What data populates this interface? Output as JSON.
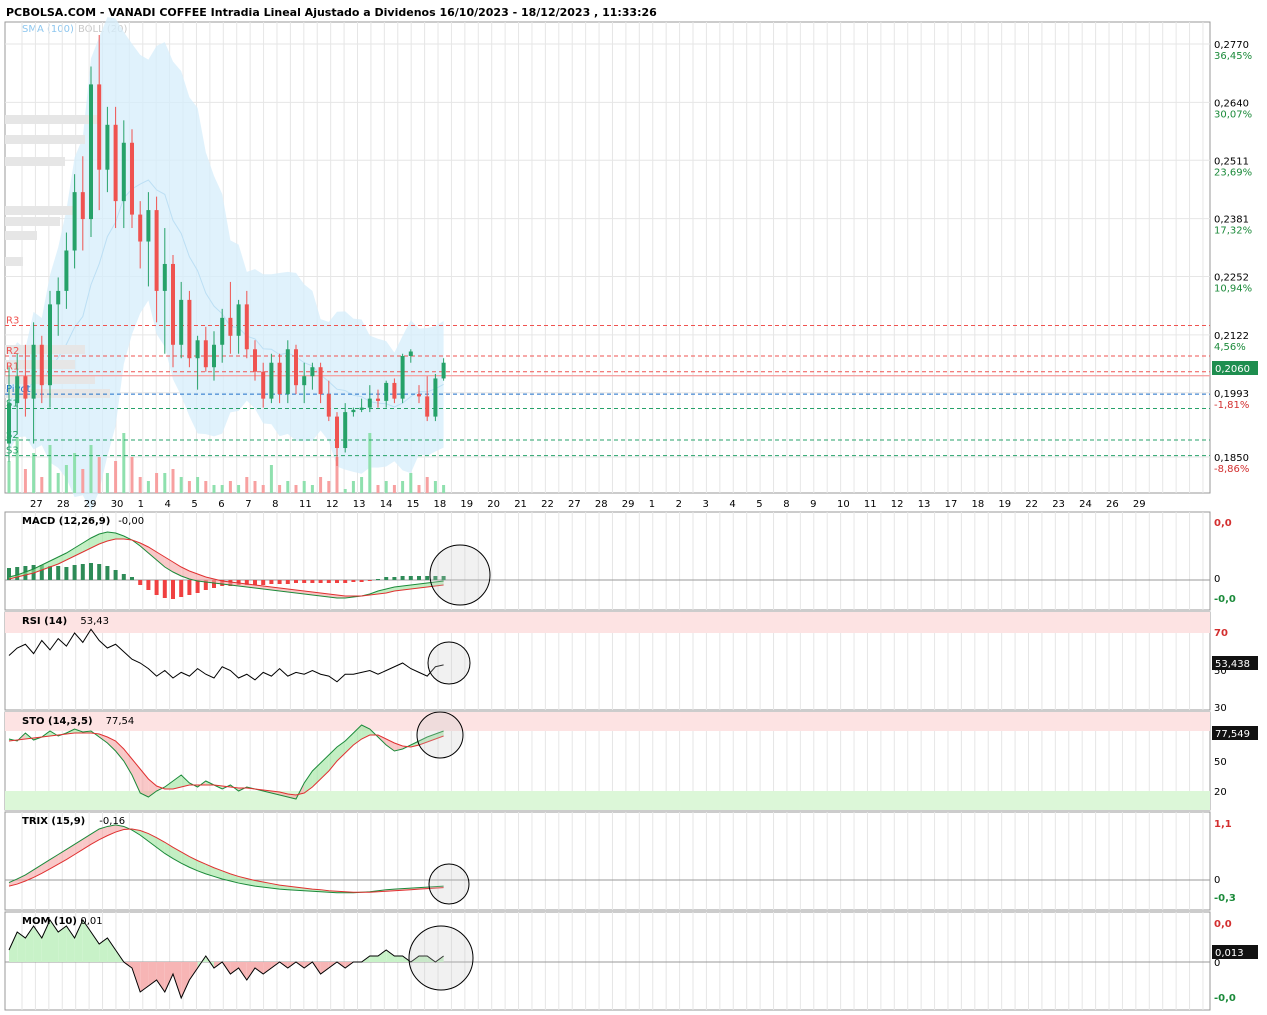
{
  "header": {
    "title": "PCBOLSA.COM - VANADI COFFEE Intradia Lineal Ajustado a Dividenos 16/10/2023 - 18/12/2023 , 11:33:26",
    "indicators": [
      "SMA (100)",
      "BOLL (20)"
    ]
  },
  "colors": {
    "up": "#26a269",
    "down": "#ef5350",
    "band": "#d6eefb",
    "pivot_up": "#ef5350",
    "pivot_down": "#26a269",
    "pivot_mid": "#1e6fc9"
  },
  "chart_data": [
    {
      "type": "candlestick",
      "name": "price",
      "y_ticks": [
        {
          "value": 0.277,
          "label": "0,2770",
          "pct": "36,45%"
        },
        {
          "value": 0.264,
          "label": "0,2640",
          "pct": "30,07%"
        },
        {
          "value": 0.2511,
          "label": "0,2511",
          "pct": "23,69%"
        },
        {
          "value": 0.2381,
          "label": "0,2381",
          "pct": "17,32%"
        },
        {
          "value": 0.2252,
          "label": "0,2252",
          "pct": "10,94%"
        },
        {
          "value": 0.2122,
          "label": "0,2122",
          "pct": "4,56%"
        },
        {
          "value": 0.1993,
          "label": "0,1993",
          "pct": "-1,81%"
        },
        {
          "value": 0.185,
          "label": "0,1850",
          "pct": "-8,86%"
        }
      ],
      "last_price": {
        "value": 0.206,
        "label": "0,2060"
      },
      "pivots": [
        {
          "label": "R3",
          "value": 0.2143,
          "kind": "up"
        },
        {
          "label": "R2",
          "value": 0.2075,
          "kind": "up"
        },
        {
          "label": "R1",
          "value": 0.204,
          "kind": "up"
        },
        {
          "label": "Pivot",
          "value": 0.199,
          "kind": "mid"
        },
        {
          "label": "S1",
          "value": 0.1958,
          "kind": "down"
        },
        {
          "label": "S2",
          "value": 0.1888,
          "kind": "down"
        },
        {
          "label": "S3",
          "value": 0.1853,
          "kind": "down"
        }
      ],
      "x_ticks": [
        "27",
        "28",
        "29",
        "30",
        "1",
        "4",
        "5",
        "6",
        "7",
        "8",
        "11",
        "12",
        "13",
        "14",
        "15",
        "18",
        "19",
        "20",
        "21",
        "22",
        "27",
        "28",
        "29",
        "1",
        "2",
        "3",
        "4",
        "5",
        "8",
        "9",
        "10",
        "11",
        "12",
        "13",
        "17",
        "18",
        "19",
        "22",
        "23",
        "24",
        "26",
        "29"
      ],
      "candles": [
        {
          "o": 0.188,
          "h": 0.205,
          "l": 0.184,
          "c": 0.197
        },
        {
          "o": 0.197,
          "h": 0.208,
          "l": 0.19,
          "c": 0.203
        },
        {
          "o": 0.203,
          "h": 0.21,
          "l": 0.194,
          "c": 0.198
        },
        {
          "o": 0.198,
          "h": 0.215,
          "l": 0.188,
          "c": 0.21
        },
        {
          "o": 0.21,
          "h": 0.212,
          "l": 0.197,
          "c": 0.201
        },
        {
          "o": 0.201,
          "h": 0.222,
          "l": 0.196,
          "c": 0.219
        },
        {
          "o": 0.219,
          "h": 0.225,
          "l": 0.212,
          "c": 0.222
        },
        {
          "o": 0.222,
          "h": 0.235,
          "l": 0.218,
          "c": 0.231
        },
        {
          "o": 0.231,
          "h": 0.248,
          "l": 0.227,
          "c": 0.244
        },
        {
          "o": 0.244,
          "h": 0.252,
          "l": 0.231,
          "c": 0.238
        },
        {
          "o": 0.238,
          "h": 0.272,
          "l": 0.234,
          "c": 0.268
        },
        {
          "o": 0.268,
          "h": 0.279,
          "l": 0.24,
          "c": 0.249
        },
        {
          "o": 0.249,
          "h": 0.263,
          "l": 0.244,
          "c": 0.259
        },
        {
          "o": 0.259,
          "h": 0.263,
          "l": 0.236,
          "c": 0.242
        },
        {
          "o": 0.242,
          "h": 0.26,
          "l": 0.236,
          "c": 0.255
        },
        {
          "o": 0.255,
          "h": 0.258,
          "l": 0.236,
          "c": 0.239
        },
        {
          "o": 0.239,
          "h": 0.242,
          "l": 0.227,
          "c": 0.233
        },
        {
          "o": 0.233,
          "h": 0.244,
          "l": 0.223,
          "c": 0.24
        },
        {
          "o": 0.24,
          "h": 0.243,
          "l": 0.215,
          "c": 0.222
        },
        {
          "o": 0.222,
          "h": 0.236,
          "l": 0.208,
          "c": 0.228
        },
        {
          "o": 0.228,
          "h": 0.23,
          "l": 0.205,
          "c": 0.21
        },
        {
          "o": 0.21,
          "h": 0.224,
          "l": 0.207,
          "c": 0.22
        },
        {
          "o": 0.22,
          "h": 0.222,
          "l": 0.205,
          "c": 0.207
        },
        {
          "o": 0.207,
          "h": 0.212,
          "l": 0.2,
          "c": 0.211
        },
        {
          "o": 0.211,
          "h": 0.214,
          "l": 0.204,
          "c": 0.205
        },
        {
          "o": 0.205,
          "h": 0.213,
          "l": 0.202,
          "c": 0.21
        },
        {
          "o": 0.21,
          "h": 0.218,
          "l": 0.206,
          "c": 0.216
        },
        {
          "o": 0.216,
          "h": 0.224,
          "l": 0.208,
          "c": 0.212
        },
        {
          "o": 0.212,
          "h": 0.22,
          "l": 0.208,
          "c": 0.219
        },
        {
          "o": 0.219,
          "h": 0.222,
          "l": 0.207,
          "c": 0.209
        },
        {
          "o": 0.209,
          "h": 0.211,
          "l": 0.202,
          "c": 0.204
        },
        {
          "o": 0.204,
          "h": 0.206,
          "l": 0.196,
          "c": 0.198
        },
        {
          "o": 0.198,
          "h": 0.208,
          "l": 0.197,
          "c": 0.206
        },
        {
          "o": 0.206,
          "h": 0.208,
          "l": 0.197,
          "c": 0.199
        },
        {
          "o": 0.199,
          "h": 0.211,
          "l": 0.197,
          "c": 0.209
        },
        {
          "o": 0.209,
          "h": 0.21,
          "l": 0.199,
          "c": 0.201
        },
        {
          "o": 0.201,
          "h": 0.206,
          "l": 0.197,
          "c": 0.203
        },
        {
          "o": 0.203,
          "h": 0.206,
          "l": 0.2,
          "c": 0.205
        },
        {
          "o": 0.205,
          "h": 0.206,
          "l": 0.197,
          "c": 0.199
        },
        {
          "o": 0.199,
          "h": 0.202,
          "l": 0.193,
          "c": 0.194
        },
        {
          "o": 0.194,
          "h": 0.195,
          "l": 0.183,
          "c": 0.187
        },
        {
          "o": 0.187,
          "h": 0.197,
          "l": 0.186,
          "c": 0.195
        },
        {
          "o": 0.195,
          "h": 0.196,
          "l": 0.194,
          "c": 0.1955
        },
        {
          "o": 0.1955,
          "h": 0.198,
          "l": 0.195,
          "c": 0.196
        },
        {
          "o": 0.196,
          "h": 0.201,
          "l": 0.195,
          "c": 0.198
        },
        {
          "o": 0.198,
          "h": 0.2,
          "l": 0.196,
          "c": 0.1975
        },
        {
          "o": 0.1975,
          "h": 0.202,
          "l": 0.196,
          "c": 0.2015
        },
        {
          "o": 0.2015,
          "h": 0.2025,
          "l": 0.197,
          "c": 0.198
        },
        {
          "o": 0.198,
          "h": 0.208,
          "l": 0.197,
          "c": 0.2075
        },
        {
          "o": 0.2075,
          "h": 0.209,
          "l": 0.206,
          "c": 0.2085
        },
        {
          "o": 0.199,
          "h": 0.201,
          "l": 0.197,
          "c": 0.1985
        },
        {
          "o": 0.1985,
          "h": 0.203,
          "l": 0.193,
          "c": 0.194
        },
        {
          "o": 0.194,
          "h": 0.2035,
          "l": 0.193,
          "c": 0.2025
        },
        {
          "o": 0.2025,
          "h": 0.207,
          "l": 0.202,
          "c": 0.206
        }
      ],
      "volume": [
        8,
        14,
        6,
        10,
        4,
        12,
        5,
        7,
        10,
        6,
        12,
        9,
        5,
        8,
        15,
        9,
        4,
        3,
        5,
        5,
        6,
        4,
        3,
        4,
        3,
        2,
        2,
        3,
        2,
        4,
        3,
        2,
        7,
        2,
        3,
        2,
        3,
        2,
        4,
        3,
        9,
        1,
        3,
        4,
        15,
        2,
        3,
        2,
        3,
        5,
        2,
        4,
        3,
        2
      ]
    },
    {
      "type": "line",
      "name": "MACD (12,26,9)",
      "value_label": "-0,00",
      "y_ticks": [
        {
          "value": 0.0,
          "label": "0,0",
          "color": "#d32f2f"
        },
        {
          "value": 0,
          "label": "0"
        },
        {
          "value": -0.0,
          "label": "-0,0",
          "color": "#1b8a3a"
        }
      ],
      "macd": [
        0.3,
        0.5,
        0.8,
        1.1,
        1.5,
        1.9,
        2.3,
        2.7,
        3.2,
        3.7,
        4.2,
        4.6,
        4.8,
        4.7,
        4.4,
        4.0,
        3.4,
        2.7,
        2.0,
        1.3,
        0.8,
        0.4,
        0.1,
        -0.1,
        -0.2,
        -0.3,
        -0.4,
        -0.5,
        -0.6,
        -0.7,
        -0.8,
        -0.9,
        -1.0,
        -1.1,
        -1.2,
        -1.3,
        -1.4,
        -1.5,
        -1.6,
        -1.7,
        -1.8,
        -1.8,
        -1.7,
        -1.6,
        -1.4,
        -1.1,
        -0.9,
        -0.7,
        -0.6,
        -0.5,
        -0.4,
        -0.3,
        -0.2,
        -0.1
      ],
      "signal": [
        0.1,
        0.3,
        0.5,
        0.7,
        1.0,
        1.3,
        1.6,
        2.0,
        2.4,
        2.8,
        3.2,
        3.6,
        3.9,
        4.1,
        4.1,
        4.0,
        3.7,
        3.3,
        2.8,
        2.3,
        1.8,
        1.3,
        0.9,
        0.6,
        0.3,
        0.1,
        -0.1,
        -0.2,
        -0.3,
        -0.4,
        -0.5,
        -0.6,
        -0.7,
        -0.8,
        -0.9,
        -1.0,
        -1.1,
        -1.2,
        -1.3,
        -1.4,
        -1.5,
        -1.6,
        -1.6,
        -1.6,
        -1.5,
        -1.4,
        -1.3,
        -1.1,
        -1.0,
        -0.9,
        -0.8,
        -0.7,
        -0.6,
        -0.5
      ],
      "hist": [
        1.2,
        1.3,
        1.4,
        1.5,
        1.5,
        1.4,
        1.4,
        1.3,
        1.5,
        1.6,
        1.7,
        1.6,
        1.4,
        1.0,
        0.6,
        0.3,
        -0.5,
        -1.0,
        -1.5,
        -1.8,
        -1.9,
        -1.7,
        -1.5,
        -1.3,
        -1.0,
        -0.8,
        -0.6,
        -0.6,
        -0.5,
        -0.5,
        -0.5,
        -0.5,
        -0.4,
        -0.4,
        -0.4,
        -0.3,
        -0.3,
        -0.3,
        -0.3,
        -0.3,
        -0.3,
        -0.3,
        -0.2,
        -0.2,
        -0.1,
        0.1,
        0.3,
        0.3,
        0.4,
        0.4,
        0.4,
        0.4,
        0.4,
        0.4
      ]
    },
    {
      "type": "line",
      "name": "RSI (14)",
      "value_label": "53,43",
      "last_label": "53,438",
      "y_ticks": [
        {
          "value": 70,
          "label": "70",
          "color": "#d32f2f"
        },
        {
          "value": 50,
          "label": "50"
        },
        {
          "value": 30,
          "label": "30"
        }
      ],
      "values": [
        58,
        62,
        64,
        59,
        66,
        61,
        67,
        63,
        70,
        65,
        72,
        66,
        62,
        64,
        60,
        56,
        54,
        51,
        47,
        50,
        46,
        49,
        47,
        51,
        48,
        46,
        52,
        50,
        46,
        48,
        45,
        49,
        47,
        51,
        47,
        49,
        48,
        50,
        48,
        47,
        44,
        48,
        48,
        49,
        50,
        48,
        50,
        52,
        54,
        51,
        49,
        47,
        52,
        53
      ]
    },
    {
      "type": "line",
      "name": "STO (14,3,5)",
      "value_label": "77,54",
      "last_label": "77,549",
      "y_ticks": [
        {
          "value": 80,
          "label": "80",
          "color": "#d32f2f"
        },
        {
          "value": 50,
          "label": "50"
        },
        {
          "value": 20,
          "label": "20"
        }
      ],
      "k": [
        72,
        70,
        78,
        71,
        74,
        80,
        75,
        78,
        82,
        79,
        80,
        74,
        68,
        60,
        50,
        36,
        18,
        14,
        20,
        24,
        30,
        36,
        28,
        24,
        30,
        26,
        22,
        26,
        20,
        24,
        22,
        20,
        18,
        16,
        14,
        12,
        28,
        40,
        48,
        56,
        64,
        70,
        78,
        86,
        82,
        74,
        66,
        60,
        62,
        66,
        70,
        74,
        77,
        80
      ],
      "d": [
        70,
        71,
        72,
        73,
        74,
        75,
        76,
        77,
        78,
        78,
        78,
        77,
        74,
        70,
        62,
        52,
        42,
        32,
        25,
        22,
        22,
        24,
        26,
        26,
        26,
        26,
        25,
        24,
        23,
        23,
        22,
        21,
        20,
        19,
        17,
        16,
        18,
        24,
        32,
        40,
        50,
        58,
        66,
        72,
        76,
        76,
        72,
        68,
        65,
        64,
        66,
        69,
        72,
        75
      ]
    },
    {
      "type": "line",
      "name": "TRIX (15,9)",
      "value_label": "-0,16",
      "y_ticks": [
        {
          "value": 1.1,
          "label": "1,1",
          "color": "#d32f2f"
        },
        {
          "value": 0,
          "label": "0"
        },
        {
          "value": -0.3,
          "label": "-0,3",
          "color": "#1b8a3a"
        }
      ],
      "trix": [
        -0.05,
        0.02,
        0.1,
        0.2,
        0.3,
        0.4,
        0.5,
        0.6,
        0.7,
        0.8,
        0.9,
        1.0,
        1.05,
        1.08,
        1.05,
        0.98,
        0.88,
        0.76,
        0.64,
        0.52,
        0.42,
        0.33,
        0.25,
        0.18,
        0.12,
        0.07,
        0.02,
        -0.02,
        -0.06,
        -0.09,
        -0.12,
        -0.14,
        -0.16,
        -0.18,
        -0.19,
        -0.2,
        -0.21,
        -0.22,
        -0.23,
        -0.24,
        -0.25,
        -0.25,
        -0.25,
        -0.24,
        -0.23,
        -0.21,
        -0.19,
        -0.18,
        -0.17,
        -0.16,
        -0.15,
        -0.14,
        -0.13,
        -0.12
      ],
      "signal": [
        -0.12,
        -0.08,
        -0.02,
        0.05,
        0.13,
        0.22,
        0.31,
        0.4,
        0.5,
        0.6,
        0.7,
        0.79,
        0.87,
        0.94,
        0.99,
        1.0,
        0.97,
        0.91,
        0.83,
        0.74,
        0.64,
        0.55,
        0.46,
        0.38,
        0.31,
        0.24,
        0.18,
        0.12,
        0.07,
        0.03,
        -0.01,
        -0.04,
        -0.07,
        -0.1,
        -0.12,
        -0.14,
        -0.16,
        -0.18,
        -0.19,
        -0.21,
        -0.22,
        -0.23,
        -0.24,
        -0.24,
        -0.24,
        -0.23,
        -0.22,
        -0.21,
        -0.2,
        -0.19,
        -0.18,
        -0.17,
        -0.16,
        -0.15
      ]
    },
    {
      "type": "area",
      "name": "MOM (10)",
      "value_label": "0,01",
      "last_label": "0,013",
      "y_ticks": [
        {
          "value": 0.0,
          "label": "0,0",
          "color": "#d32f2f"
        },
        {
          "value": 0,
          "label": "0"
        },
        {
          "value": -0.0,
          "label": "-0,0",
          "color": "#1b8a3a"
        }
      ],
      "values": [
        0.02,
        0.05,
        0.04,
        0.06,
        0.04,
        0.07,
        0.05,
        0.06,
        0.04,
        0.07,
        0.05,
        0.03,
        0.04,
        0.02,
        0.0,
        -0.01,
        -0.05,
        -0.04,
        -0.03,
        -0.05,
        -0.02,
        -0.06,
        -0.03,
        -0.01,
        0.01,
        -0.01,
        0.0,
        -0.02,
        -0.01,
        -0.03,
        -0.01,
        -0.02,
        -0.01,
        0.0,
        -0.01,
        0.0,
        -0.01,
        0.0,
        -0.02,
        -0.01,
        0.0,
        -0.01,
        0.0,
        0.0,
        0.01,
        0.01,
        0.02,
        0.01,
        0.01,
        0.0,
        0.01,
        0.01,
        0.0,
        0.01
      ]
    }
  ]
}
